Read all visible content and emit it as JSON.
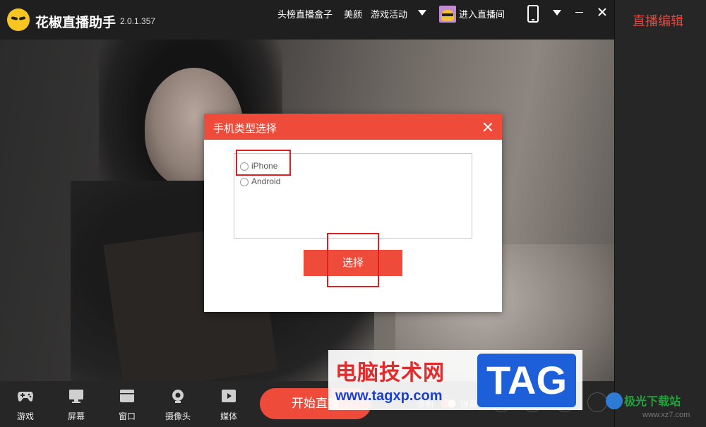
{
  "app": {
    "title": "花椒直播助手",
    "version": "2.0.1.357"
  },
  "header": {
    "nav": [
      {
        "label": "头榜直播盒子"
      },
      {
        "label": "美颜"
      },
      {
        "label": "游戏活动"
      }
    ],
    "enter_room": "进入直播间"
  },
  "right_panel": {
    "title": "直播编辑"
  },
  "modal": {
    "title": "手机类型选择",
    "options": [
      {
        "label": "iPhone",
        "selected": false
      },
      {
        "label": "Android",
        "selected": false
      }
    ],
    "select_button": "选择"
  },
  "toolbar": {
    "items": [
      {
        "label": "游戏",
        "icon": "gamepad-icon"
      },
      {
        "label": "屏幕",
        "icon": "monitor-icon"
      },
      {
        "label": "窗口",
        "icon": "window-icon"
      },
      {
        "label": "摄像头",
        "icon": "camera-icon"
      },
      {
        "label": "媒体",
        "icon": "media-icon"
      }
    ],
    "start_button": "开始直播",
    "record_label": "录制",
    "barrage_label": "弹幕"
  },
  "watermark": {
    "line1": "电脑技术网",
    "line2": "www.tagxp.com",
    "tag": "TAG",
    "site": "极光下载站",
    "site_url": "www.xz7.com"
  },
  "colors": {
    "accent": "#ef4b3b",
    "title_red": "#e8463b"
  }
}
